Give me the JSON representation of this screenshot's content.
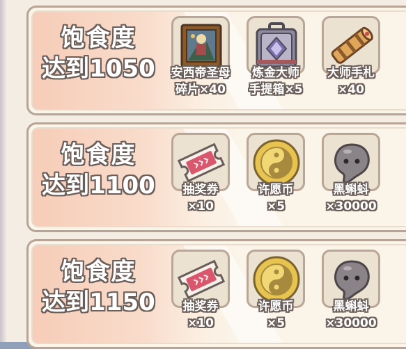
{
  "milestones": [
    {
      "goal_line1": "饱食度",
      "goal_line2": "达到1050",
      "rewards": [
        {
          "name": "安西帝圣母",
          "qty": "碎片×40",
          "icon": "painting-icon"
        },
        {
          "name": "炼金大师",
          "qty": "手提箱×5",
          "icon": "suitcase-icon"
        },
        {
          "name": "大师手札",
          "qty": "×40",
          "icon": "scroll-icon"
        }
      ]
    },
    {
      "goal_line1": "饱食度",
      "goal_line2": "达到1100",
      "rewards": [
        {
          "name": "抽奖券",
          "qty": "×10",
          "icon": "ticket-icon"
        },
        {
          "name": "许愿币",
          "qty": "×5",
          "icon": "yin-yang-coin-icon"
        },
        {
          "name": "黑蝌蚪",
          "qty": "×30000",
          "icon": "black-tadpole-icon"
        }
      ]
    },
    {
      "goal_line1": "饱食度",
      "goal_line2": "达到1150",
      "rewards": [
        {
          "name": "抽奖券",
          "qty": "×10",
          "icon": "ticket-icon"
        },
        {
          "name": "许愿币",
          "qty": "×5",
          "icon": "yin-yang-coin-icon"
        },
        {
          "name": "黑蝌蚪",
          "qty": "×30000",
          "icon": "black-tadpole-icon"
        }
      ]
    }
  ]
}
